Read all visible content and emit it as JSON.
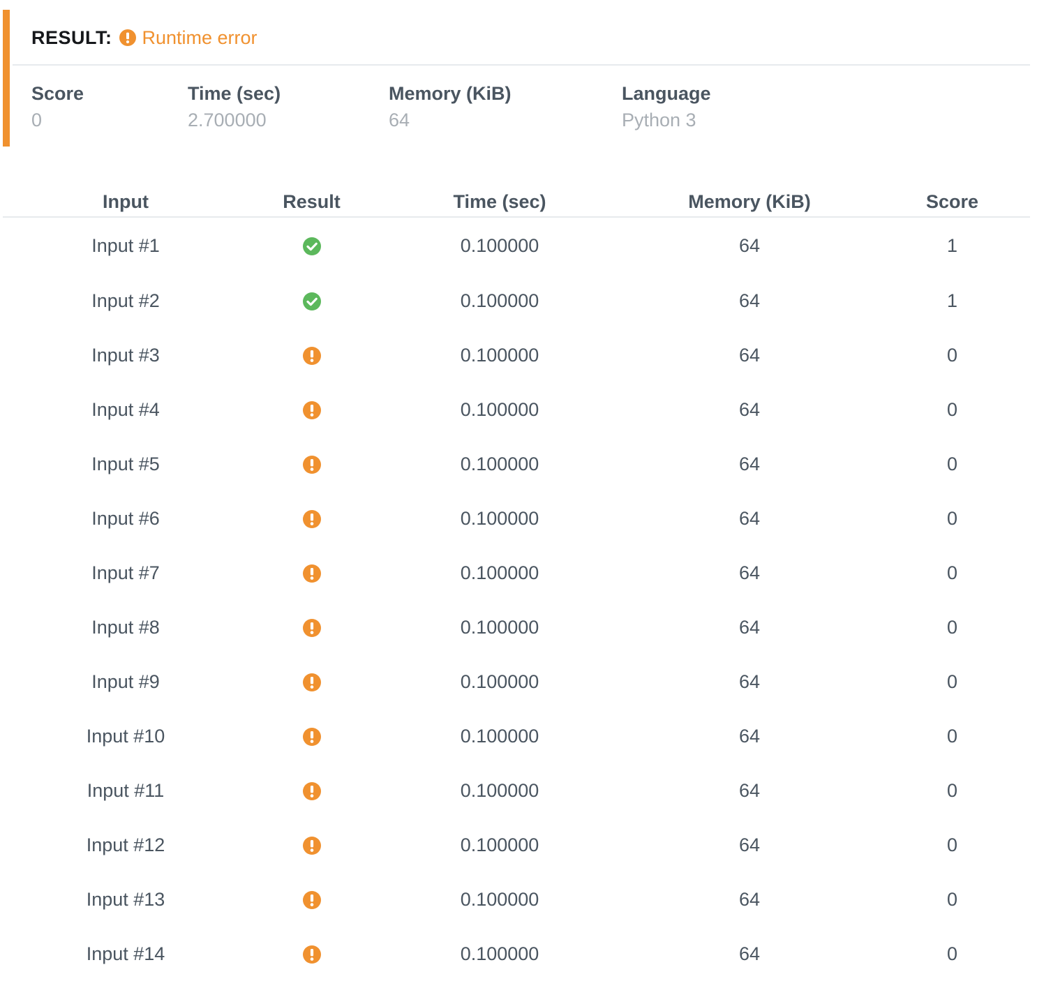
{
  "summary": {
    "result_label": "RESULT:",
    "status_icon": "exclamation-circle-icon",
    "status_text": "Runtime error",
    "accent_color": "#f0912f",
    "stats": [
      {
        "label": "Score",
        "value": "0"
      },
      {
        "label": "Time (sec)",
        "value": "2.700000"
      },
      {
        "label": "Memory (KiB)",
        "value": "64"
      },
      {
        "label": "Language",
        "value": "Python 3"
      }
    ]
  },
  "table": {
    "columns": [
      "Input",
      "Result",
      "Time (sec)",
      "Memory (KiB)",
      "Score"
    ],
    "status_colors": {
      "passed": "#5cb85c",
      "error": "#f0912f"
    },
    "status_icons": {
      "passed": "check-circle-icon",
      "error": "exclamation-circle-icon"
    },
    "rows": [
      {
        "input": "Input #1",
        "result": "passed",
        "time": "0.100000",
        "memory": "64",
        "score": "1"
      },
      {
        "input": "Input #2",
        "result": "passed",
        "time": "0.100000",
        "memory": "64",
        "score": "1"
      },
      {
        "input": "Input #3",
        "result": "error",
        "time": "0.100000",
        "memory": "64",
        "score": "0"
      },
      {
        "input": "Input #4",
        "result": "error",
        "time": "0.100000",
        "memory": "64",
        "score": "0"
      },
      {
        "input": "Input #5",
        "result": "error",
        "time": "0.100000",
        "memory": "64",
        "score": "0"
      },
      {
        "input": "Input #6",
        "result": "error",
        "time": "0.100000",
        "memory": "64",
        "score": "0"
      },
      {
        "input": "Input #7",
        "result": "error",
        "time": "0.100000",
        "memory": "64",
        "score": "0"
      },
      {
        "input": "Input #8",
        "result": "error",
        "time": "0.100000",
        "memory": "64",
        "score": "0"
      },
      {
        "input": "Input #9",
        "result": "error",
        "time": "0.100000",
        "memory": "64",
        "score": "0"
      },
      {
        "input": "Input #10",
        "result": "error",
        "time": "0.100000",
        "memory": "64",
        "score": "0"
      },
      {
        "input": "Input #11",
        "result": "error",
        "time": "0.100000",
        "memory": "64",
        "score": "0"
      },
      {
        "input": "Input #12",
        "result": "error",
        "time": "0.100000",
        "memory": "64",
        "score": "0"
      },
      {
        "input": "Input #13",
        "result": "error",
        "time": "0.100000",
        "memory": "64",
        "score": "0"
      },
      {
        "input": "Input #14",
        "result": "error",
        "time": "0.100000",
        "memory": "64",
        "score": "0"
      }
    ]
  }
}
